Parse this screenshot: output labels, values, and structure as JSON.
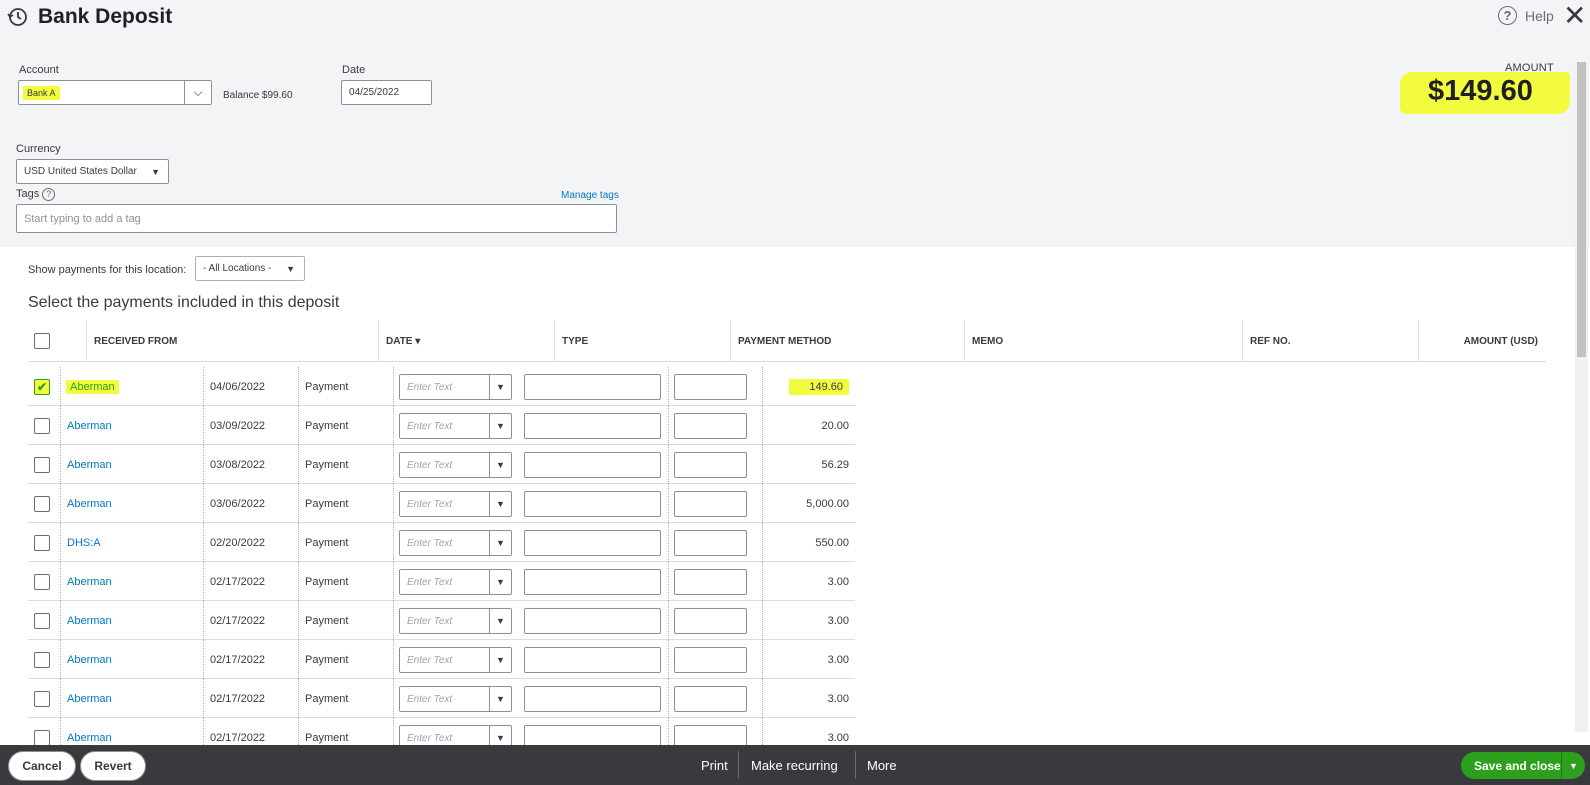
{
  "header": {
    "title": "Bank Deposit",
    "help": "Help"
  },
  "account": {
    "label": "Account",
    "value": "Bank A",
    "balance": "Balance $99.60"
  },
  "date": {
    "label": "Date",
    "value": "04/25/2022"
  },
  "amount": {
    "label": "AMOUNT",
    "value": "$149.60"
  },
  "currency": {
    "label": "Currency",
    "value": "USD United States Dollar"
  },
  "tags": {
    "label": "Tags",
    "placeholder": "Start typing to add a tag",
    "manage": "Manage tags"
  },
  "location": {
    "label": "Show payments for this location:",
    "value": "- All Locations -"
  },
  "section_title": "Select the payments included in this deposit",
  "table": {
    "columns": [
      "RECEIVED FROM",
      "DATE ▾",
      "TYPE",
      "PAYMENT METHOD",
      "MEMO",
      "REF NO.",
      "AMOUNT (USD)"
    ],
    "placeholder": "Enter Text",
    "rows": [
      {
        "from": "Aberman",
        "date": "04/06/2022",
        "type": "Payment",
        "amount": "149.60",
        "checked": true
      },
      {
        "from": "Aberman",
        "date": "03/09/2022",
        "type": "Payment",
        "amount": "20.00",
        "checked": false
      },
      {
        "from": "Aberman",
        "date": "03/08/2022",
        "type": "Payment",
        "amount": "56.29",
        "checked": false
      },
      {
        "from": "Aberman",
        "date": "03/06/2022",
        "type": "Payment",
        "amount": "5,000.00",
        "checked": false
      },
      {
        "from": "DHS:A",
        "date": "02/20/2022",
        "type": "Payment",
        "amount": "550.00",
        "checked": false
      },
      {
        "from": "Aberman",
        "date": "02/17/2022",
        "type": "Payment",
        "amount": "3.00",
        "checked": false
      },
      {
        "from": "Aberman",
        "date": "02/17/2022",
        "type": "Payment",
        "amount": "3.00",
        "checked": false
      },
      {
        "from": "Aberman",
        "date": "02/17/2022",
        "type": "Payment",
        "amount": "3.00",
        "checked": false
      },
      {
        "from": "Aberman",
        "date": "02/17/2022",
        "type": "Payment",
        "amount": "3.00",
        "checked": false
      },
      {
        "from": "Aberman",
        "date": "02/17/2022",
        "type": "Payment",
        "amount": "3.00",
        "checked": false
      }
    ]
  },
  "footer": {
    "cancel": "Cancel",
    "revert": "Revert",
    "print": "Print",
    "recurring": "Make recurring",
    "more": "More",
    "save": "Save and close"
  },
  "colors": {
    "highlight": "#f3fb3f",
    "accent": "#2ca01c",
    "link": "#0077c5",
    "footer": "#393a3d"
  }
}
